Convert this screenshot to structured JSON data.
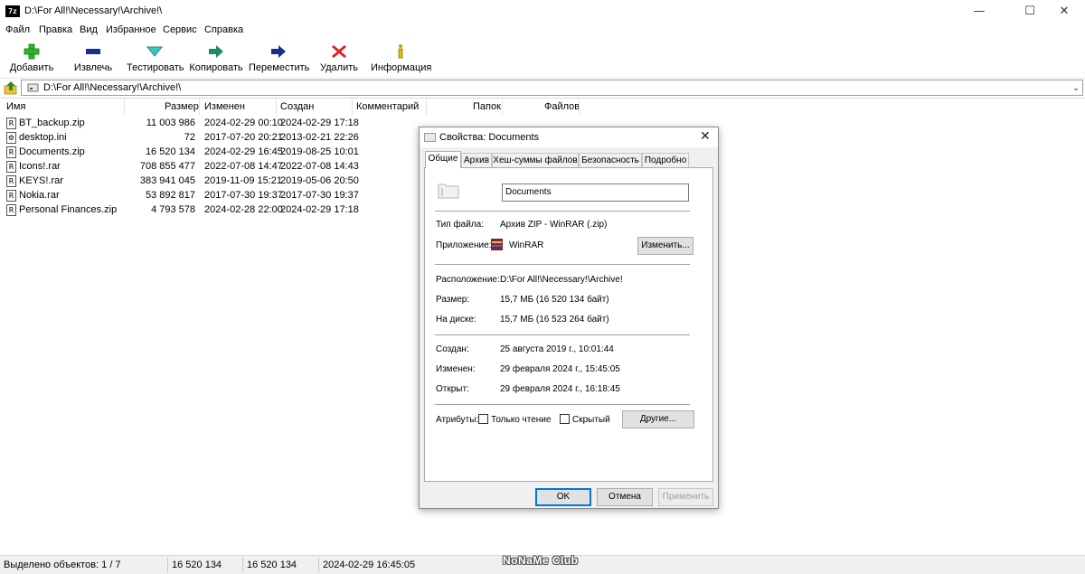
{
  "window": {
    "app_icon_text": "7z",
    "title": "D:\\For All!\\Necessary!\\Archive!\\",
    "minimize": "—",
    "maximize": "☐",
    "close": "✕"
  },
  "menu": [
    "Файл",
    "Правка",
    "Вид",
    "Избранное",
    "Сервис",
    "Справка"
  ],
  "toolbar": [
    {
      "label": "Добавить",
      "icon": "plus-icon",
      "color": "#2bb52b"
    },
    {
      "label": "Извлечь",
      "icon": "minus-icon",
      "color": "#1a2f8c"
    },
    {
      "label": "Тестировать",
      "icon": "check-icon",
      "color": "#2ab0a8"
    },
    {
      "label": "Копировать",
      "icon": "copy-arrow-icon",
      "color": "#1b8a6b"
    },
    {
      "label": "Переместить",
      "icon": "arrow-right-icon",
      "color": "#1a2f8c"
    },
    {
      "label": "Удалить",
      "icon": "delete-x-icon",
      "color": "#d62020"
    },
    {
      "label": "Информация",
      "icon": "info-icon",
      "color": "#c8a000"
    }
  ],
  "address": {
    "path": "D:\\For All!\\Necessary!\\Archive!\\",
    "dropdown": "⌄"
  },
  "columns": {
    "name": "Имя",
    "size": "Размер",
    "modified": "Изменен",
    "created": "Создан",
    "comment": "Комментарий",
    "folders": "Папок",
    "files": "Файлов"
  },
  "files": [
    {
      "name": "BT_backup.zip",
      "size": "11 003 986",
      "modified": "2024-02-29 00:10",
      "created": "2024-02-29 17:18",
      "icon": "R"
    },
    {
      "name": "desktop.ini",
      "size": "72",
      "modified": "2017-07-20 20:21",
      "created": "2013-02-21 22:26",
      "icon": "⚙"
    },
    {
      "name": "Documents.zip",
      "size": "16 520 134",
      "modified": "2024-02-29 16:45",
      "created": "2019-08-25 10:01",
      "icon": "R"
    },
    {
      "name": "Icons!.rar",
      "size": "708 855 477",
      "modified": "2022-07-08 14:47",
      "created": "2022-07-08 14:43",
      "icon": "R"
    },
    {
      "name": "KEYS!.rar",
      "size": "383 941 045",
      "modified": "2019-11-09 15:21",
      "created": "2019-05-06 20:50",
      "icon": "R"
    },
    {
      "name": "Nokia.rar",
      "size": "53 892 817",
      "modified": "2017-07-30 19:37",
      "created": "2017-07-30 19:37",
      "icon": "R"
    },
    {
      "name": "Personal Finances.zip",
      "size": "4 793 578",
      "modified": "2024-02-28 22:00",
      "created": "2024-02-29 17:18",
      "icon": "R"
    }
  ],
  "status": {
    "selected": "Выделено объектов: 1 / 7",
    "size": "16 520 134",
    "packed": "16 520 134",
    "date": "2024-02-29 16:45:05",
    "watermark": "NoNaMe Club"
  },
  "dialog": {
    "title": "Свойства: Documents",
    "close": "✕",
    "tabs": [
      "Общие",
      "Архив",
      "Хеш-суммы файлов",
      "Безопасность",
      "Подробно"
    ],
    "name": "Documents",
    "type_label": "Тип файла:",
    "type_value": "Архив ZIP - WinRAR (.zip)",
    "app_label": "Приложение:",
    "app_value": "WinRAR",
    "change_button": "Изменить...",
    "location_label": "Расположение:",
    "location_value": "D:\\For All!\\Necessary!\\Archive!",
    "size_label": "Размер:",
    "size_value": "15,7 МБ (16 520 134 байт)",
    "disk_label": "На диске:",
    "disk_value": "15,7 МБ (16 523 264 байт)",
    "created_label": "Создан:",
    "created_value": "25 августа 2019 г., 10:01:44",
    "modified_label": "Изменен:",
    "modified_value": "29 февраля 2024 г., 15:45:05",
    "opened_label": "Открыт:",
    "opened_value": "29 февраля 2024 г., 16:18:45",
    "attributes_label": "Атрибуты:",
    "readonly_label": "Только чтение",
    "hidden_label": "Скрытый",
    "other_button": "Другие...",
    "ok_button": "OK",
    "cancel_button": "Отмена",
    "apply_button": "Применить"
  }
}
